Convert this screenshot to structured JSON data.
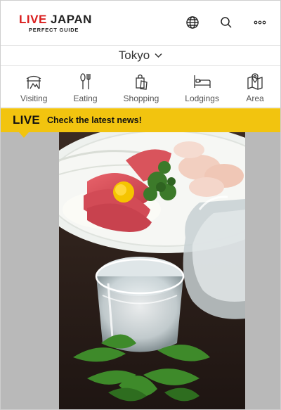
{
  "logo": {
    "text_live": "LIVE",
    "text_japan": "JAPAN",
    "subtitle": "PERFECT GUIDE"
  },
  "header_icons": [
    "globe-icon",
    "search-icon",
    "more-icon"
  ],
  "city": {
    "label": "Tokyo"
  },
  "nav": {
    "items": [
      {
        "label": "Visiting",
        "icon": "visiting-icon"
      },
      {
        "label": "Eating",
        "icon": "eating-icon"
      },
      {
        "label": "Shopping",
        "icon": "shopping-icon"
      },
      {
        "label": "Lodgings",
        "icon": "lodgings-icon"
      },
      {
        "label": "Area",
        "icon": "area-icon"
      }
    ]
  },
  "live_banner": {
    "tag": "LIVE",
    "message": "Check the latest news!"
  },
  "colors": {
    "brand_red": "#d91d1d",
    "banner_yellow": "#f2c40f",
    "side_gray": "#b9b9b9"
  }
}
